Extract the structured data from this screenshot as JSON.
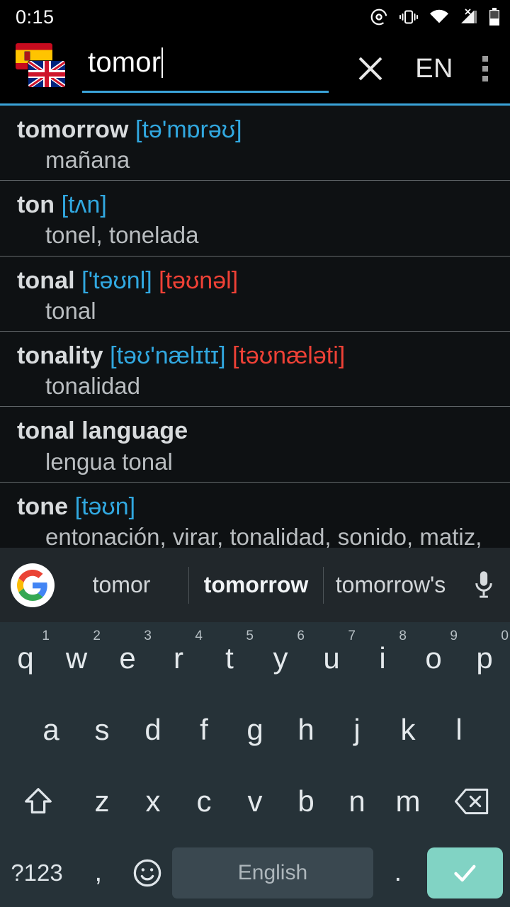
{
  "status_bar": {
    "clock": "0:15",
    "icons": [
      "add-circle-icon",
      "vibrate-icon",
      "wifi-icon",
      "no-sim-signal-icon",
      "battery-icon"
    ]
  },
  "toolbar": {
    "flag_source": "es",
    "flag_target": "gb",
    "search_value": "tomor",
    "search_placeholder": "",
    "clear_label": "clear-icon",
    "language_label": "EN",
    "overflow_label": "more-options-icon",
    "accent_color": "#3aa3d8"
  },
  "results": {
    "entries": [
      {
        "term": "tomorrow",
        "ipa_uk": "[tə'mɒrəʊ]",
        "ipa_us": "",
        "translation": "mañana"
      },
      {
        "term": "ton",
        "ipa_uk": "[tʌn]",
        "ipa_us": "",
        "translation": "tonel, tonelada"
      },
      {
        "term": "tonal",
        "ipa_uk": "['təʊnl]",
        "ipa_us": "[təʊnəl]",
        "translation": "tonal"
      },
      {
        "term": "tonality",
        "ipa_uk": "[təʊ'nælɪtɪ]",
        "ipa_us": "[təʊnæləti]",
        "translation": "tonalidad"
      },
      {
        "term": "tonal language",
        "ipa_uk": "",
        "ipa_us": "",
        "translation": "lengua tonal"
      },
      {
        "term": "tone",
        "ipa_uk": "[təʊn]",
        "ipa_us": "",
        "translation": "entonación, virar, tonalidad, sonido, matiz, acento, tono, voz"
      }
    ],
    "ipa_uk_color": "#31a8e0",
    "ipa_us_color": "#ef4136"
  },
  "suggestion_bar": {
    "logo": "google-logo",
    "items": [
      "tomor",
      "tomorrow",
      "tomorrow's"
    ],
    "primary_index": 1,
    "mic_label": "microphone-icon"
  },
  "keyboard": {
    "row1": [
      {
        "key": "q",
        "hint": "1"
      },
      {
        "key": "w",
        "hint": "2"
      },
      {
        "key": "e",
        "hint": "3"
      },
      {
        "key": "r",
        "hint": "4"
      },
      {
        "key": "t",
        "hint": "5"
      },
      {
        "key": "y",
        "hint": "6"
      },
      {
        "key": "u",
        "hint": "7"
      },
      {
        "key": "i",
        "hint": "8"
      },
      {
        "key": "o",
        "hint": "9"
      },
      {
        "key": "p",
        "hint": "0"
      }
    ],
    "row2": [
      "a",
      "s",
      "d",
      "f",
      "g",
      "h",
      "j",
      "k",
      "l"
    ],
    "row3": [
      "z",
      "x",
      "c",
      "v",
      "b",
      "n",
      "m"
    ],
    "shift_label": "shift-icon",
    "backspace_label": "backspace-icon",
    "symbols_label": "?123",
    "comma_label": ",",
    "emoji_label": "emoji-icon",
    "space_label": "English",
    "period_label": ".",
    "enter_label": "check-icon",
    "enter_color": "#81d3c4",
    "background": "#263238"
  }
}
